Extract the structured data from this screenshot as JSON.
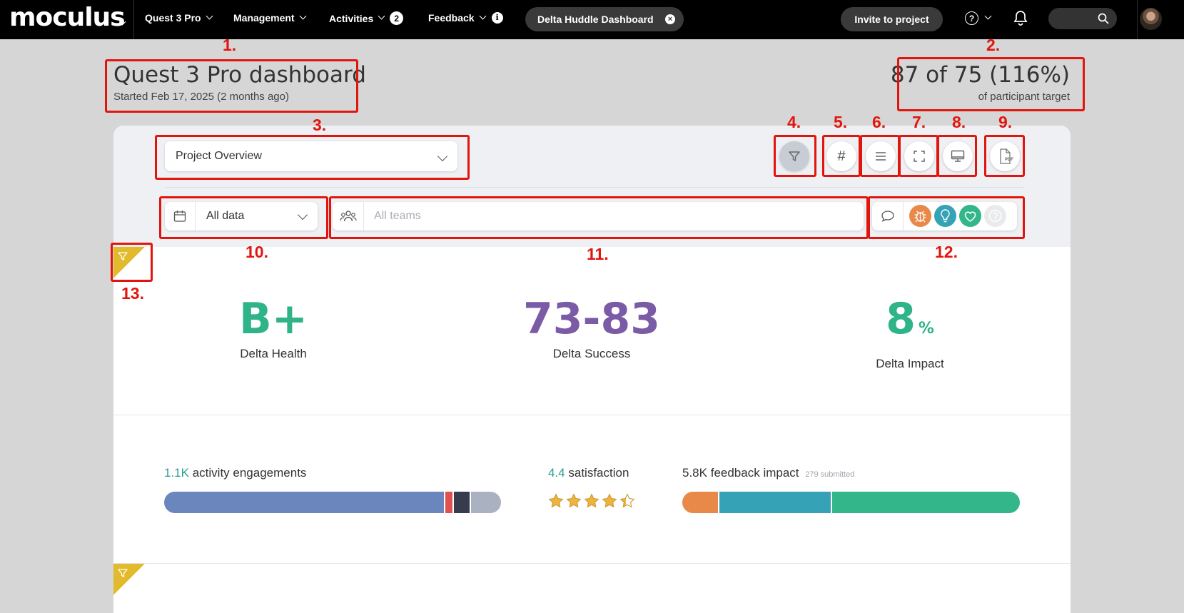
{
  "nav": {
    "logo": "moculus",
    "items": [
      {
        "label": "Quest 3 Pro"
      },
      {
        "label": "Management"
      },
      {
        "label": "Activities",
        "badge": "2"
      },
      {
        "label": "Feedback"
      }
    ],
    "active_dashboard": "Delta Huddle Dashboard",
    "invite_label": "Invite to project",
    "help_glyph": "?"
  },
  "header": {
    "title": "Quest 3 Pro dashboard",
    "subtitle": "Started Feb 17, 2025 (2 months ago)",
    "target_value": "87 of 75 (116%)",
    "target_label": "of participant target"
  },
  "toolbar": {
    "view_select": "Project Overview",
    "date_select": "All data",
    "teams_placeholder": "All teams",
    "pdf_label": "PDF",
    "buttons": [
      "filter-icon",
      "hash-icon",
      "list-icon",
      "fullscreen-icon",
      "monitor-icon",
      "pdf-icon"
    ]
  },
  "feedback_filters": [
    {
      "name": "bug-icon",
      "color": "#e8894a"
    },
    {
      "name": "lightbulb-icon",
      "color": "#35a3b5"
    },
    {
      "name": "heart-icon",
      "color": "#33b78a"
    },
    {
      "name": "question-icon",
      "color": "#e9eaec"
    }
  ],
  "kpis": [
    {
      "value": "B+",
      "label": "Delta Health",
      "color": "#2fb388"
    },
    {
      "value": "73-83",
      "label": "Delta Success",
      "color": "#7b5aa6"
    },
    {
      "value": "8",
      "unit": "%",
      "label": "Delta Impact",
      "color": "#2fb388"
    }
  ],
  "stats": {
    "engagements": {
      "value": "1.1K",
      "label": "activity engagements",
      "segments": [
        {
          "fraction": 0.835,
          "color": "#6a86bd"
        },
        {
          "fraction": 0.025,
          "color": "#e05252"
        },
        {
          "fraction": 0.05,
          "color": "#363b4e"
        },
        {
          "fraction": 0.09,
          "color": "#aab2c2"
        }
      ]
    },
    "satisfaction": {
      "value": "4.4",
      "label": "satisfaction",
      "rating": 4.4,
      "max": 5
    },
    "feedback": {
      "value": "5.8K",
      "label": "feedback impact",
      "note": "279 submitted",
      "segments": [
        {
          "fraction": 0.11,
          "color": "#e8894a"
        },
        {
          "fraction": 0.335,
          "color": "#35a3b5"
        },
        {
          "fraction": 0.555,
          "color": "#33b78a"
        }
      ]
    }
  },
  "annotations": [
    "1.",
    "2.",
    "3.",
    "4.",
    "5.",
    "6.",
    "7.",
    "8.",
    "9.",
    "10.",
    "11.",
    "12.",
    "13."
  ]
}
